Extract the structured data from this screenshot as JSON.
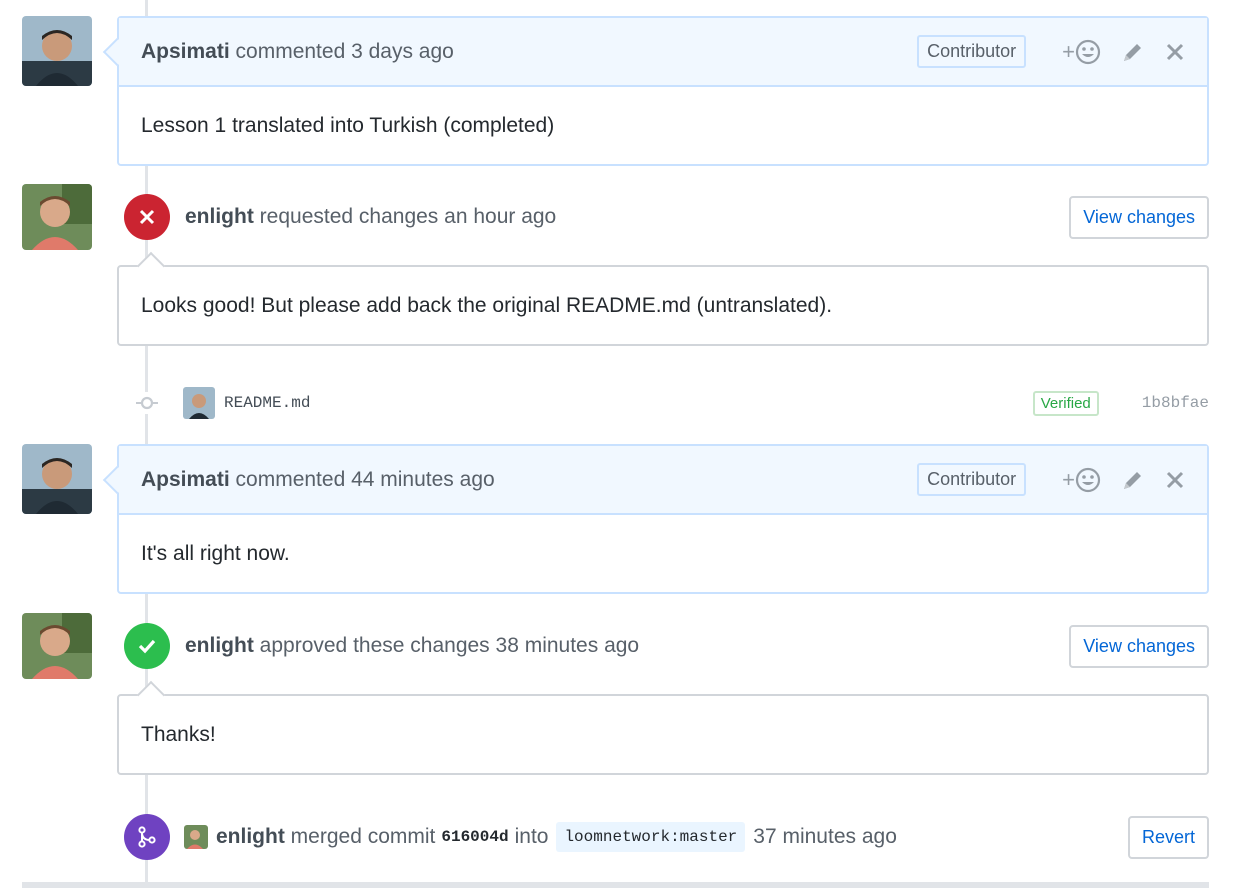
{
  "colors": {
    "requested_changes": "#cb2431",
    "approved": "#2cbe4e",
    "merged": "#6f42c1",
    "link": "#0366d6",
    "verified": "#28a745"
  },
  "comment1": {
    "author": "Apsimati",
    "action": "commented 3 days ago",
    "badge": "Contributor",
    "body": "Lesson 1 translated into Turkish (completed)",
    "reaction_label": "+",
    "icons": [
      "smiley-icon",
      "pencil-icon",
      "close-icon"
    ]
  },
  "review1": {
    "author": "enlight",
    "action": "requested changes an hour ago",
    "button": "View changes",
    "body": "Looks good! But please add back the original README.md (untranslated).",
    "icon": "x-icon"
  },
  "commit": {
    "message": "README.md",
    "verified": "Verified",
    "sha": "1b8bfae"
  },
  "comment2": {
    "author": "Apsimati",
    "action": "commented 44 minutes ago",
    "badge": "Contributor",
    "body": "It's all right now.",
    "reaction_label": "+"
  },
  "review2": {
    "author": "enlight",
    "action": "approved these changes 38 minutes ago",
    "button": "View changes",
    "body": "Thanks!",
    "icon": "check-icon"
  },
  "merge": {
    "author": "enlight",
    "action": "merged commit",
    "sha": "616004d",
    "into": "into",
    "branch": "loomnetwork:master",
    "time": "37 minutes ago",
    "button": "Revert"
  }
}
